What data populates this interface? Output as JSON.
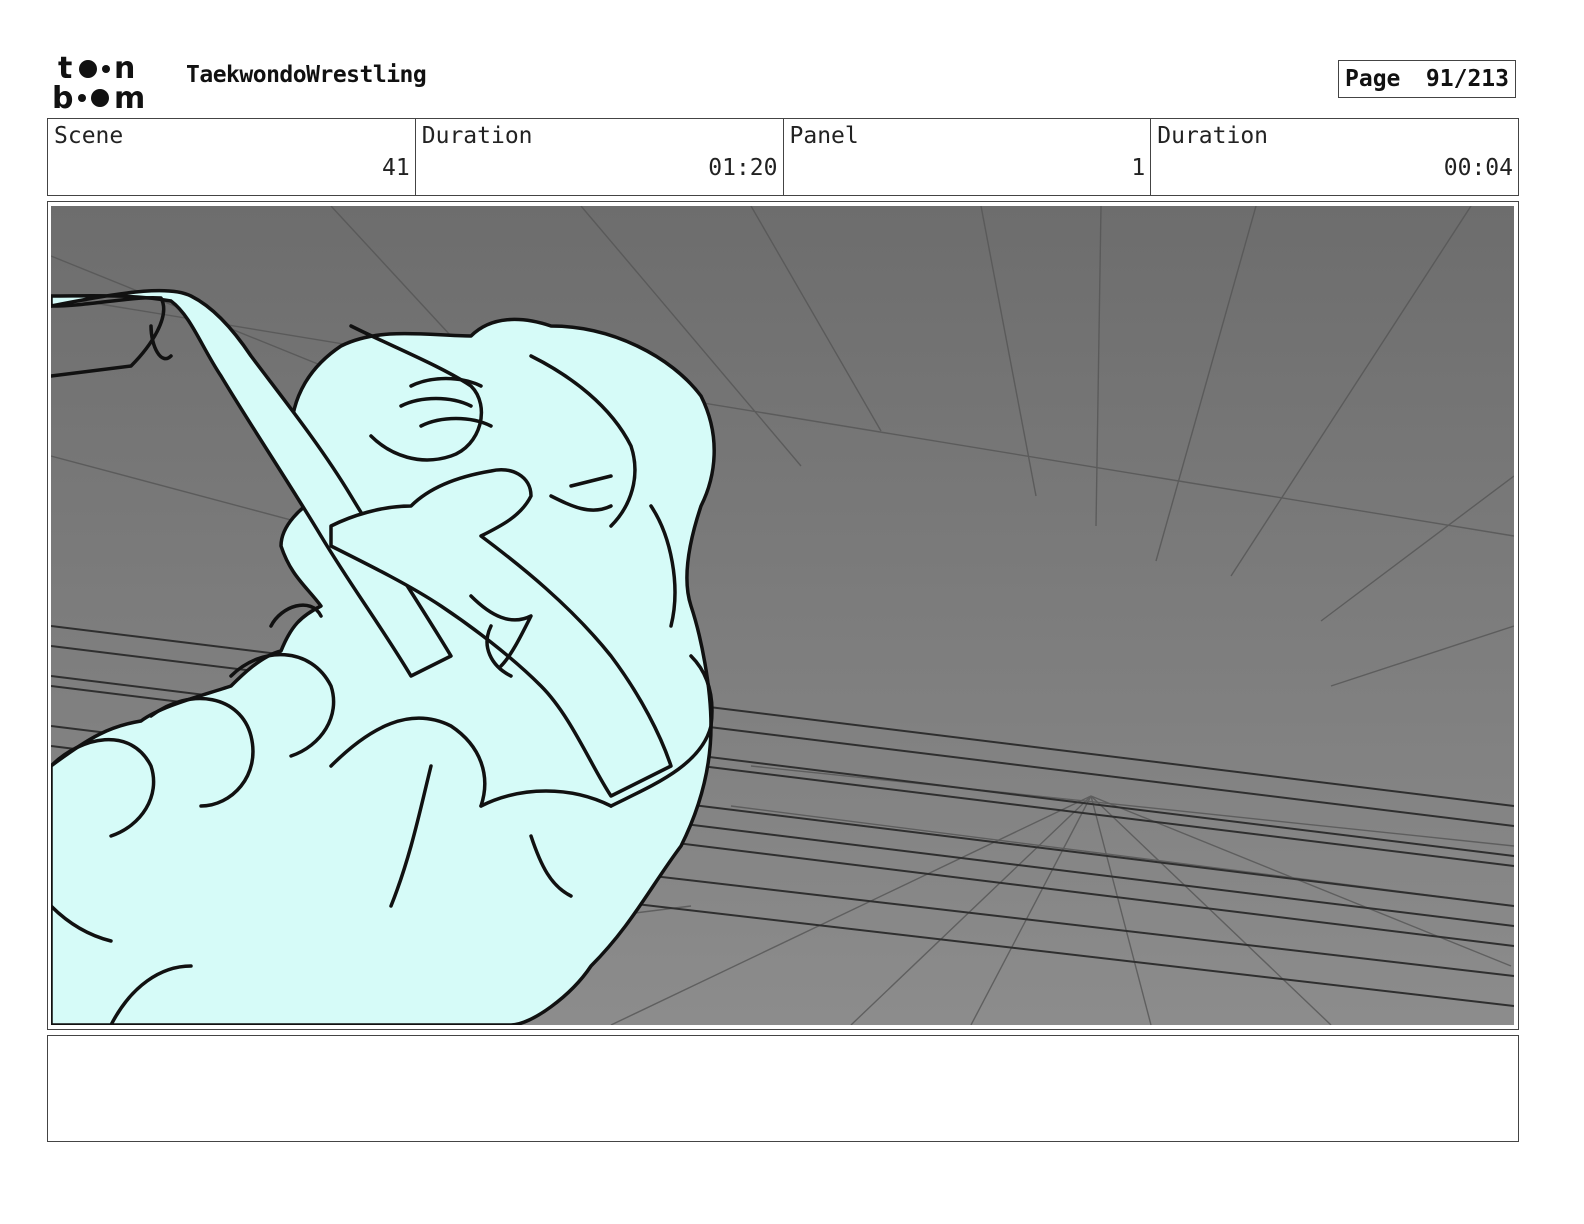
{
  "header": {
    "logo_name": "toonboom-logo",
    "project_title": "TaekwondoWrestling",
    "page_label": "Page",
    "page_number": "91/213"
  },
  "info": [
    {
      "label": "Scene",
      "value": "41"
    },
    {
      "label": "Duration",
      "value": "01:20"
    },
    {
      "label": "Panel",
      "value": "1"
    },
    {
      "label": "Duration",
      "value": "00:04"
    }
  ],
  "panel": {
    "description_icon": "storyboard-sketch",
    "colors": {
      "background_dark": "#6f6f6f",
      "background_light": "#8a8a8a",
      "figure_fill": "#d6fbf8",
      "line": "#111111"
    }
  },
  "notes": {
    "text": ""
  }
}
